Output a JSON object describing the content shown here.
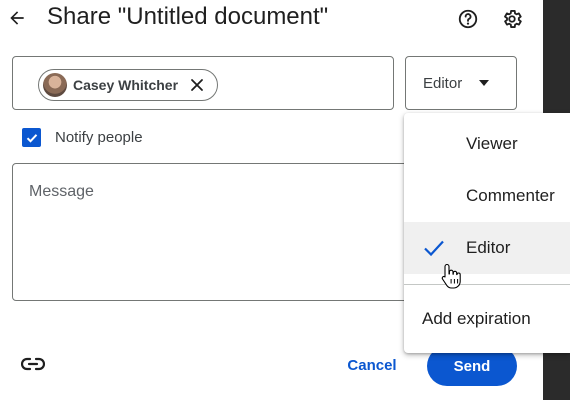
{
  "dialog": {
    "title": "Share \"Untitled document\"",
    "icons": {
      "back": "arrow-left-icon",
      "help": "help-circle-icon",
      "settings": "gear-icon"
    }
  },
  "people": {
    "chips": [
      {
        "name": "Casey Whitcher",
        "avatar": "avatar",
        "remove_icon": "close-icon"
      }
    ]
  },
  "role_select": {
    "value": "Editor",
    "icon": "caret-down-icon"
  },
  "notify": {
    "label": "Notify people",
    "checked": true
  },
  "message": {
    "placeholder": "Message",
    "value": ""
  },
  "footer": {
    "link_icon": "link-icon",
    "cancel_label": "Cancel",
    "send_label": "Send"
  },
  "role_menu": {
    "items": [
      {
        "label": "Viewer",
        "selected": false
      },
      {
        "label": "Commenter",
        "selected": false
      },
      {
        "label": "Editor",
        "selected": true
      }
    ],
    "extra": {
      "label": "Add expiration"
    }
  },
  "colors": {
    "accent": "#0b57d0",
    "text": "#1f1f1f",
    "border": "#747775",
    "hover": "#f0f0f0"
  }
}
